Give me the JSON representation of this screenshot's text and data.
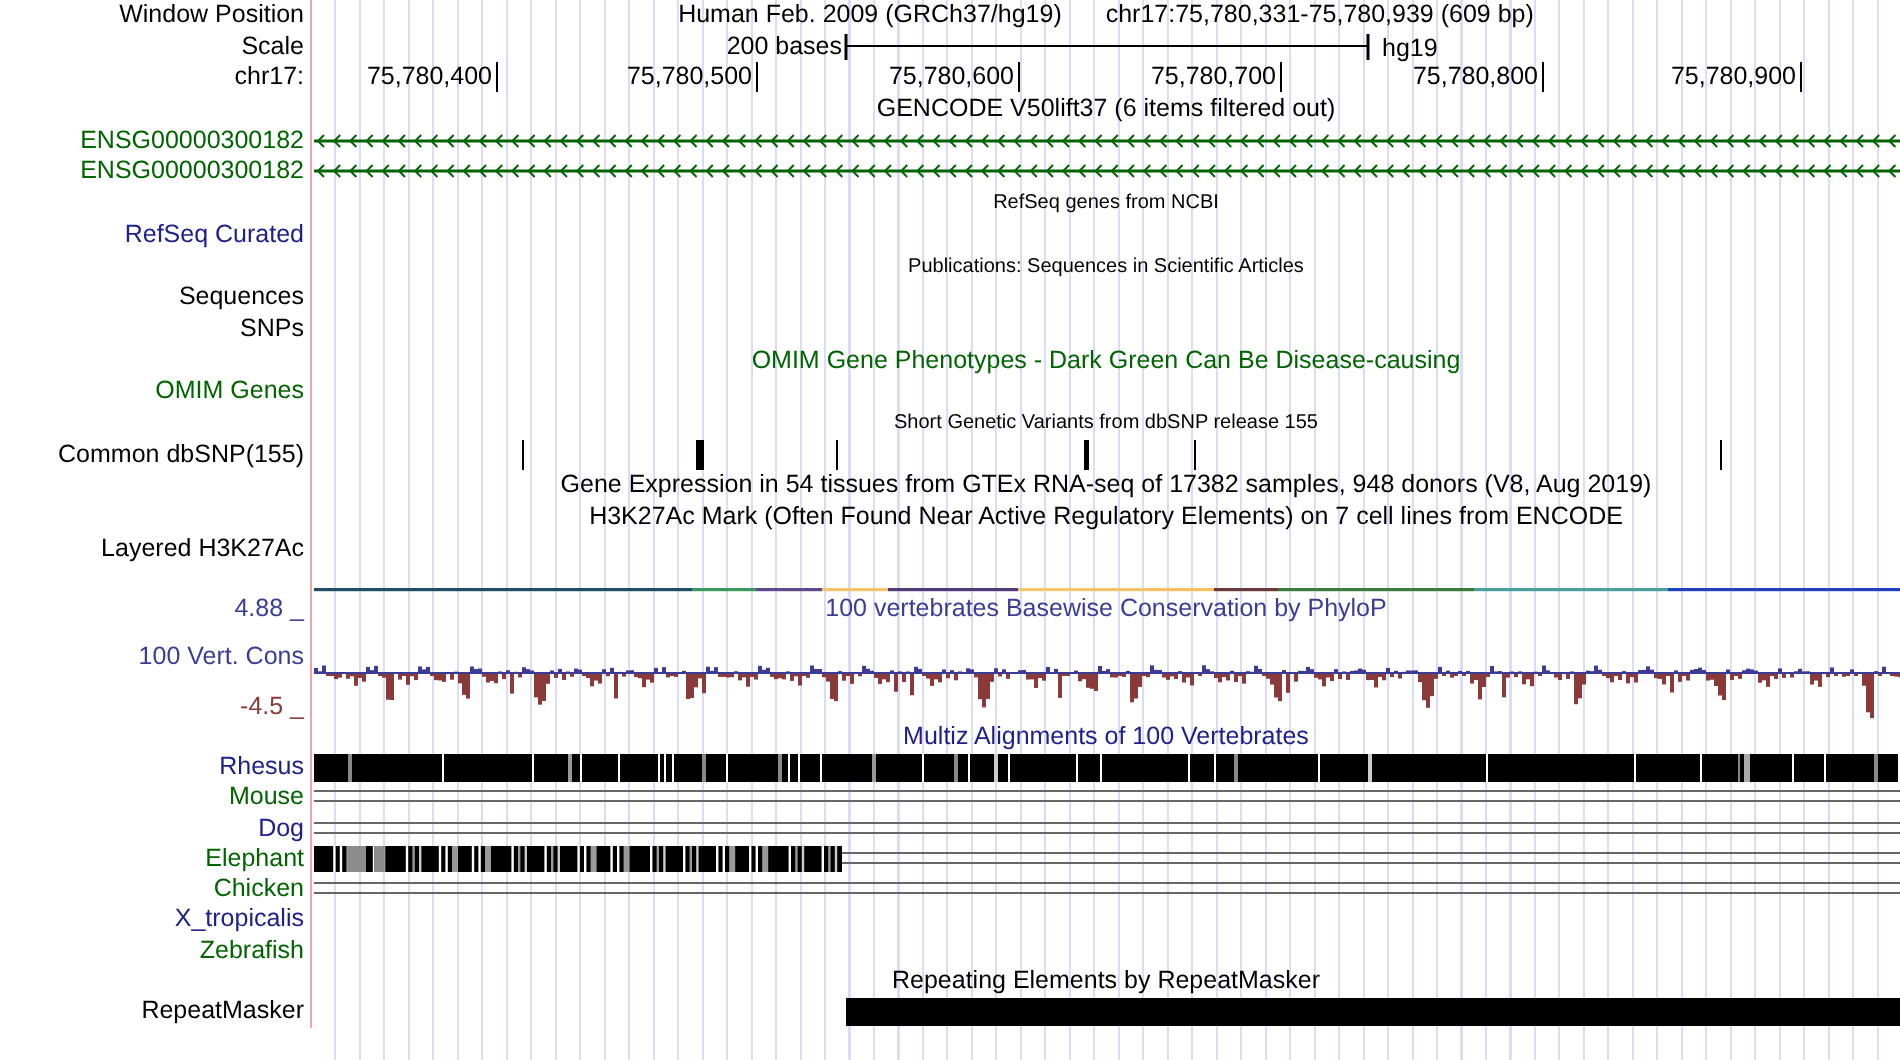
{
  "rows": [
    {
      "kind": "position",
      "label": "Window Position",
      "texts": [
        "Human Feb. 2009 (GRCh37/hg19)",
        "chr17:75,780,331-75,780,939 (609 bp)"
      ]
    },
    {
      "kind": "scale",
      "label": "Scale",
      "text": "200 bases",
      "assembly": "hg19"
    },
    {
      "kind": "ruler",
      "label": "chr17:",
      "ticks": [
        "75,780,400",
        "75,780,500",
        "75,780,600",
        "75,780,700",
        "75,780,800",
        "75,780,900"
      ]
    },
    {
      "kind": "title",
      "title": "GENCODE V50lift37 (6 items filtered out)"
    },
    {
      "kind": "gene",
      "label": "ENSG00000300182",
      "color": "#006400"
    },
    {
      "kind": "gene",
      "label": "ENSG00000300182",
      "color": "#006400"
    },
    {
      "kind": "note",
      "title": "RefSeq genes from NCBI"
    },
    {
      "kind": "empty",
      "label": "RefSeq Curated",
      "color": "#20208c"
    },
    {
      "kind": "note",
      "title": "Publications: Sequences in Scientific Articles"
    },
    {
      "kind": "empty",
      "label": "Sequences"
    },
    {
      "kind": "empty",
      "label": "SNPs"
    },
    {
      "kind": "title",
      "title": "OMIM Gene Phenotypes - Dark Green Can Be Disease-causing",
      "color": "#006400"
    },
    {
      "kind": "empty",
      "label": "OMIM Genes",
      "color": "#006400"
    },
    {
      "kind": "note",
      "title": "Short Genetic Variants from dbSNP release 155"
    },
    {
      "kind": "snp",
      "label": "Common dbSNP(155)"
    },
    {
      "kind": "title",
      "title": "Gene Expression in 54 tissues from GTEx RNA-seq of 17382 samples, 948 donors (V8, Aug 2019)"
    },
    {
      "kind": "title",
      "title": "H3K27Ac Mark (Often Found Near Active Regulatory Elements) on 7 cell lines from ENCODE"
    },
    {
      "kind": "layered",
      "label": "Layered H3K27Ac"
    },
    {
      "kind": "wiggle",
      "title": "100 vertebrates Basewise Conservation by PhyloP",
      "color": "#3c3c96",
      "labels": [
        {
          "text": "4.88 _",
          "color": "#3c3c96"
        },
        {
          "text": "100 Vert. Cons",
          "color": "#3c3c96"
        },
        {
          "text": "-4.5 _",
          "color": "#8b3a3a"
        }
      ]
    },
    {
      "kind": "title",
      "title": "Multiz Alignments of 100 Vertebrates",
      "color": "#20208c"
    },
    {
      "kind": "full-align",
      "label": "Rhesus",
      "color": "#20208c"
    },
    {
      "kind": "gap-align",
      "label": "Mouse",
      "color": "#006400"
    },
    {
      "kind": "gap-align",
      "label": "Dog",
      "color": "#20208c"
    },
    {
      "kind": "part-align",
      "label": "Elephant",
      "color": "#006400"
    },
    {
      "kind": "gap-align",
      "label": "Chicken",
      "color": "#006400"
    },
    {
      "kind": "empty",
      "label": "X_tropicalis",
      "color": "#20208c"
    },
    {
      "kind": "empty",
      "label": "Zebrafish",
      "color": "#006400"
    },
    {
      "kind": "title",
      "title": "Repeating Elements by RepeatMasker"
    },
    {
      "kind": "repeat",
      "label": "RepeatMasker"
    }
  ]
}
